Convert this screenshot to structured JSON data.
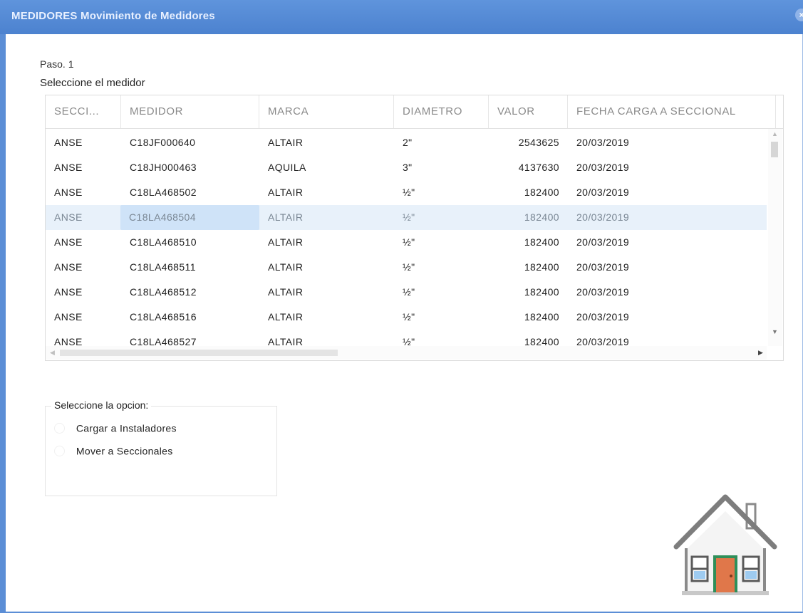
{
  "window": {
    "title": "MEDIDORES Movimiento de Medidores",
    "close_symbol": "×",
    "accent_color": "#5b8ed6"
  },
  "step": {
    "label": "Paso. 1",
    "instruction": "Seleccione el medidor"
  },
  "grid": {
    "columns": [
      "SECCI...",
      "MEDIDOR",
      "MARCA",
      "DIAMETRO",
      "VALOR",
      "FECHA CARGA A SECCIONAL"
    ],
    "rows": [
      {
        "seccional": "ANSE",
        "medidor": "C18JF000640",
        "marca": "ALTAIR",
        "diametro": "2\"",
        "valor": "2543625",
        "fecha": "20/03/2019"
      },
      {
        "seccional": "ANSE",
        "medidor": "C18JH000463",
        "marca": "AQUILA",
        "diametro": "3\"",
        "valor": "4137630",
        "fecha": "20/03/2019"
      },
      {
        "seccional": "ANSE",
        "medidor": "C18LA468502",
        "marca": "ALTAIR",
        "diametro": "½\"",
        "valor": "182400",
        "fecha": "20/03/2019"
      },
      {
        "seccional": "ANSE",
        "medidor": "C18LA468504",
        "marca": "ALTAIR",
        "diametro": "½\"",
        "valor": "182400",
        "fecha": "20/03/2019"
      },
      {
        "seccional": "ANSE",
        "medidor": "C18LA468510",
        "marca": "ALTAIR",
        "diametro": "½\"",
        "valor": "182400",
        "fecha": "20/03/2019"
      },
      {
        "seccional": "ANSE",
        "medidor": "C18LA468511",
        "marca": "ALTAIR",
        "diametro": "½\"",
        "valor": "182400",
        "fecha": "20/03/2019"
      },
      {
        "seccional": "ANSE",
        "medidor": "C18LA468512",
        "marca": "ALTAIR",
        "diametro": "½\"",
        "valor": "182400",
        "fecha": "20/03/2019"
      },
      {
        "seccional": "ANSE",
        "medidor": "C18LA468516",
        "marca": "ALTAIR",
        "diametro": "½\"",
        "valor": "182400",
        "fecha": "20/03/2019"
      },
      {
        "seccional": "ANSE",
        "medidor": "C18LA468527",
        "marca": "ALTAIR",
        "diametro": "½\"",
        "valor": "182400",
        "fecha": "20/03/2019"
      }
    ],
    "selected_row_index": 3,
    "selection_color": "#e8f1fa"
  },
  "options": {
    "legend": "Seleccione la opcion:",
    "items": [
      {
        "label": "Cargar a Instaladores",
        "checked": false
      },
      {
        "label": "Mover a Seccionales",
        "checked": false
      }
    ]
  },
  "home_button": {
    "icon": "house-icon"
  }
}
